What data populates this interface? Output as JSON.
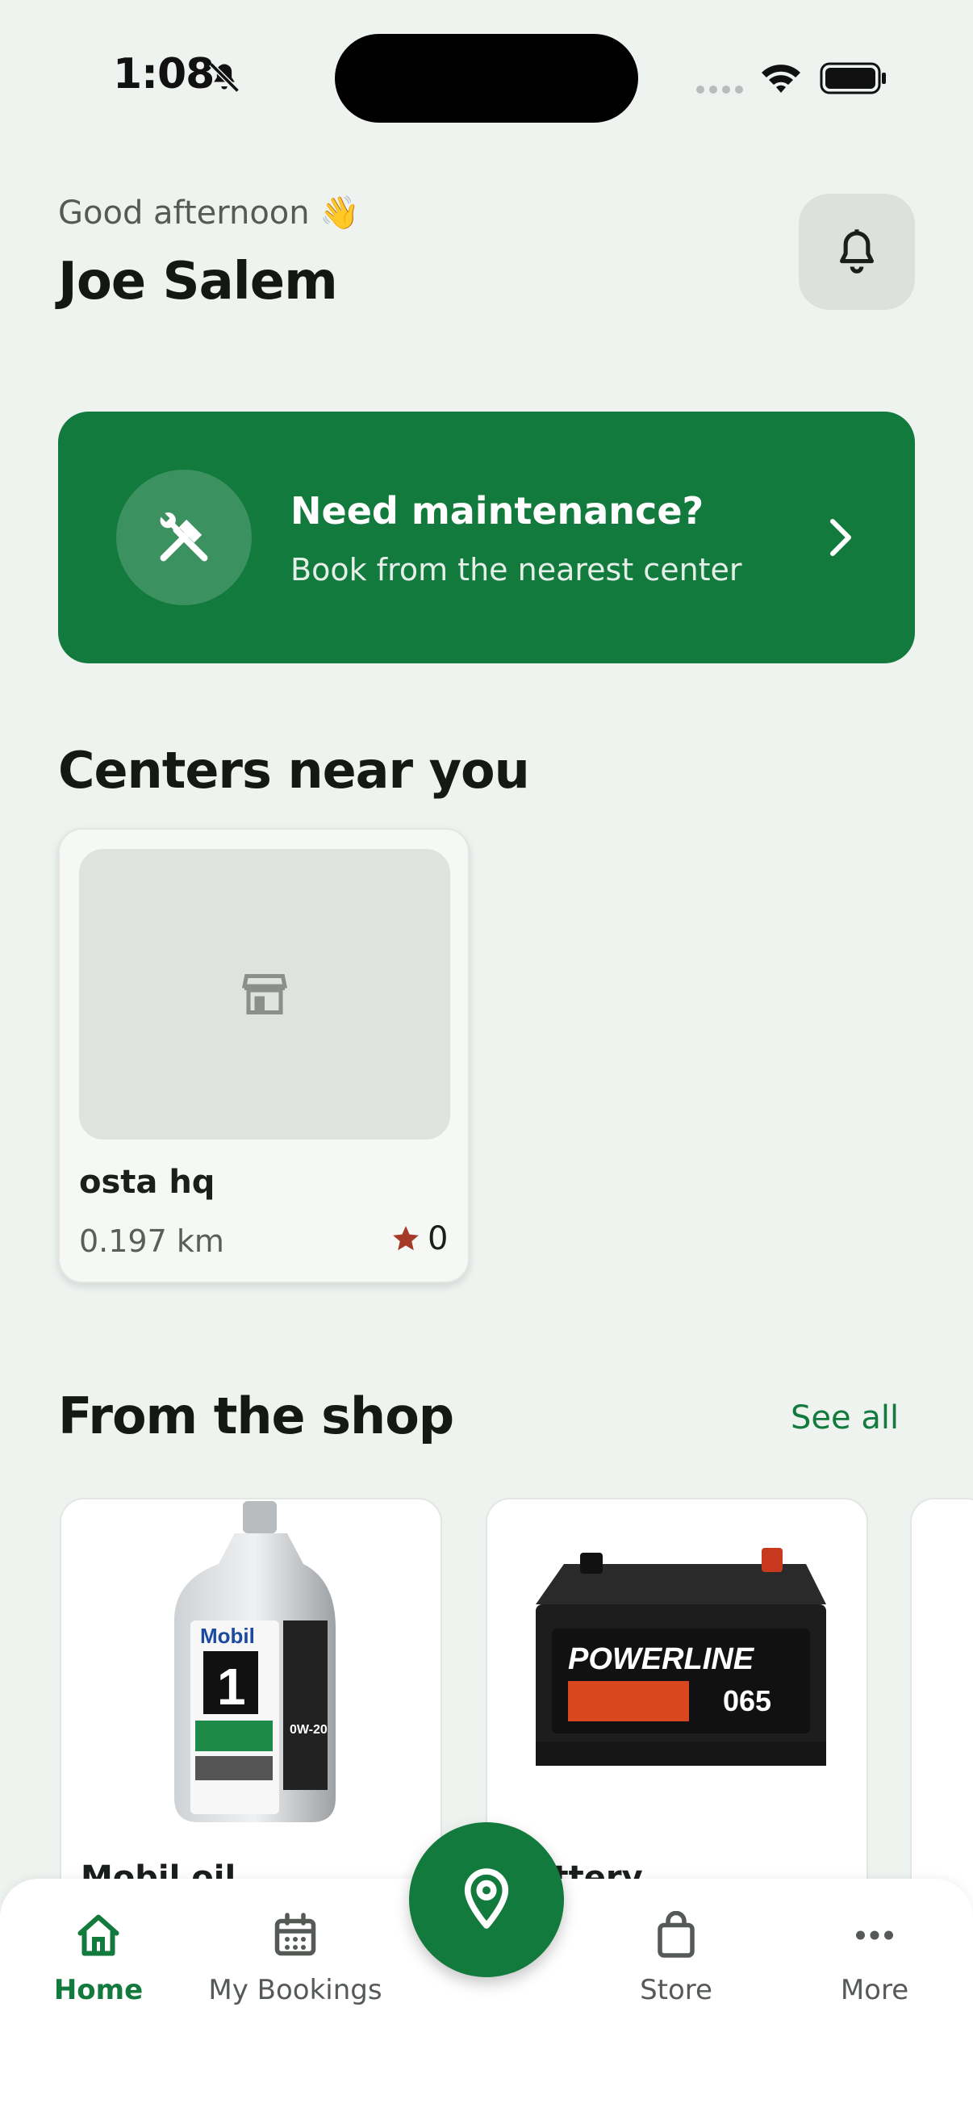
{
  "status_bar": {
    "time": "1:08"
  },
  "header": {
    "greeting": "Good afternoon 👋",
    "user_name": "Joe Salem"
  },
  "banner": {
    "title": "Need maintenance?",
    "subtitle": "Book from the nearest center"
  },
  "centers": {
    "title": "Centers near you",
    "items": [
      {
        "name": "osta hq",
        "distance": "0.197 km",
        "rating": "0"
      }
    ]
  },
  "shop": {
    "title": "From the shop",
    "see_all": "See all",
    "products": [
      {
        "name": "Mobil oil",
        "image_icon": "oil-bottle-icon"
      },
      {
        "name": "Battery",
        "image_icon": "car-battery-icon"
      }
    ]
  },
  "nav": {
    "items": [
      {
        "label": "Home",
        "icon": "home-icon",
        "active": true
      },
      {
        "label": "My Bookings",
        "icon": "calendar-icon",
        "active": false
      },
      {
        "label": "Store",
        "icon": "shopping-bag-icon",
        "active": false
      },
      {
        "label": "More",
        "icon": "more-dots-icon",
        "active": false
      }
    ],
    "fab_icon": "location-pin-icon"
  },
  "colors": {
    "primary": "#137a3e",
    "background": "#eef3f0",
    "rating_star": "#a53a27"
  }
}
